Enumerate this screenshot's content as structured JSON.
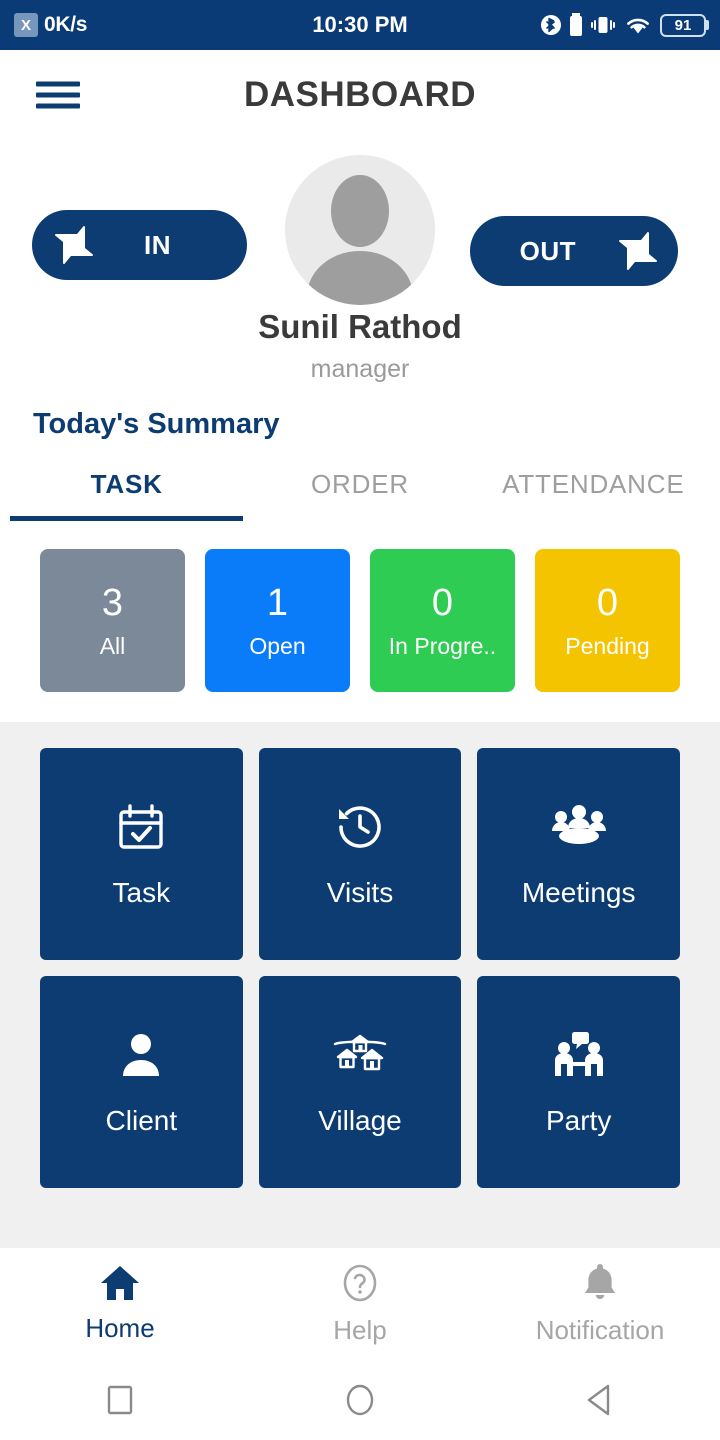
{
  "statusbar": {
    "network_badge": "X",
    "network_speed": "0K/s",
    "time": "10:30 PM",
    "battery_percent": "91",
    "icons": [
      "bluetooth-icon",
      "bluetooth-battery-icon",
      "vibrate-icon",
      "wifi-icon",
      "battery-icon"
    ]
  },
  "appbar": {
    "title": "DASHBOARD",
    "menu_icon": "hamburger-menu-icon"
  },
  "profile": {
    "name": "Sunil Rathod",
    "role": "manager",
    "avatar_icon": "default-avatar-icon",
    "punch_in_label": "IN",
    "punch_out_label": "OUT",
    "camera_icon": "camera-aperture-icon"
  },
  "summary": {
    "title": "Today's Summary",
    "tabs": [
      {
        "label": "TASK",
        "active": true
      },
      {
        "label": "ORDER",
        "active": false
      },
      {
        "label": "ATTENDANCE",
        "active": false
      }
    ],
    "stats": [
      {
        "count": "3",
        "label": "All",
        "color": "#7c8999"
      },
      {
        "count": "1",
        "label": "Open",
        "color": "#0a7cfa"
      },
      {
        "count": "0",
        "label": "In Progre..",
        "color": "#2ecc52"
      },
      {
        "count": "0",
        "label": "Pending",
        "color": "#f5c400"
      }
    ]
  },
  "grid": {
    "tiles": [
      {
        "label": "Task",
        "icon": "calendar-check-icon"
      },
      {
        "label": "Visits",
        "icon": "clock-history-icon"
      },
      {
        "label": "Meetings",
        "icon": "group-meeting-icon"
      },
      {
        "label": "Client",
        "icon": "person-icon"
      },
      {
        "label": "Village",
        "icon": "village-huts-icon"
      },
      {
        "label": "Party",
        "icon": "two-people-chat-icon"
      }
    ]
  },
  "bottomnav": {
    "items": [
      {
        "label": "Home",
        "icon": "home-icon",
        "active": true
      },
      {
        "label": "Help",
        "icon": "question-circle-icon",
        "active": false
      },
      {
        "label": "Notification",
        "icon": "bell-icon",
        "active": false
      }
    ]
  },
  "androidnav": {
    "items": [
      {
        "icon": "recents-square-icon"
      },
      {
        "icon": "home-circle-icon"
      },
      {
        "icon": "back-triangle-icon"
      }
    ]
  },
  "colors": {
    "brand_navy": "#0d3c73",
    "statusbar_navy": "#0b3b76",
    "grid_bg": "#f0f0f0",
    "muted_gray": "#9e9e9e"
  }
}
